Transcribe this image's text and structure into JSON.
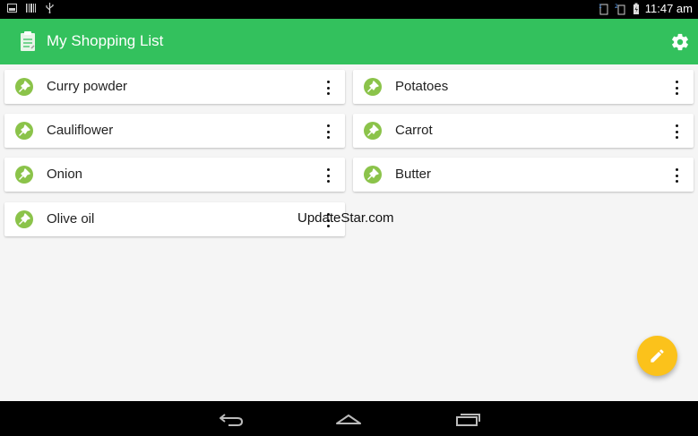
{
  "status_bar": {
    "time": "11:47 am",
    "icons_left": [
      "picture-icon",
      "barcode-icon",
      "usb-icon"
    ],
    "icons_right": [
      "sim-icon",
      "signal-icon",
      "battery-icon"
    ]
  },
  "app_bar": {
    "title": "My Shopping List",
    "icon": "clipboard-icon",
    "action_icon": "settings-gear-icon",
    "background": "#33c15d"
  },
  "items": [
    {
      "label": "Curry powder"
    },
    {
      "label": "Potatoes"
    },
    {
      "label": "Cauliflower"
    },
    {
      "label": "Carrot"
    },
    {
      "label": "Onion"
    },
    {
      "label": "Butter"
    },
    {
      "label": "Olive oil"
    }
  ],
  "watermark": "UpdateStar.com",
  "fab": {
    "icon": "pencil-icon",
    "color": "#fbc21b"
  },
  "nav_bar": {
    "icons": [
      "back-icon",
      "home-icon",
      "recent-apps-icon"
    ]
  },
  "colors": {
    "pin": "#8bc34a",
    "card": "#ffffff",
    "background": "#f5f5f5"
  }
}
